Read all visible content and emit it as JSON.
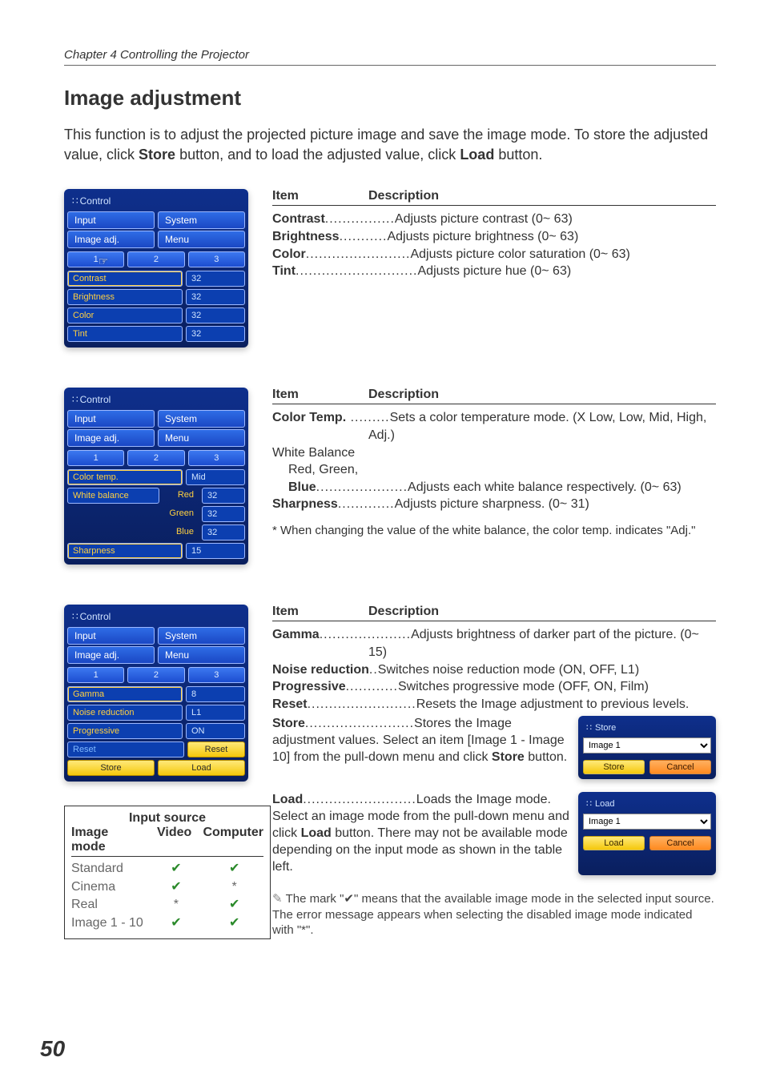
{
  "chapter": "Chapter 4 Controlling the Projector",
  "title": "Image adjustment",
  "intro_a": "This function is to adjust the projected picture image and save the image mode. To store the adjusted value, click ",
  "intro_b": "Store",
  "intro_c": " button, and to load the adjusted value, click ",
  "intro_d": "Load",
  "intro_e": " button.",
  "hdr_item": "Item",
  "hdr_desc": "Description",
  "panel_common": {
    "title": "Control",
    "input": "Input",
    "system": "System",
    "image_adj": "Image adj.",
    "menu": "Menu",
    "tab1": "1",
    "tab2": "2",
    "tab3": "3"
  },
  "panel1": {
    "rows": [
      {
        "label": "Contrast",
        "val": "32"
      },
      {
        "label": "Brightness",
        "val": "32"
      },
      {
        "label": "Color",
        "val": "32"
      },
      {
        "label": "Tint",
        "val": "32"
      }
    ]
  },
  "panel2": {
    "colortemp_label": "Color temp.",
    "colortemp_val": "Mid",
    "wb_label": "White balance",
    "wb": [
      {
        "label": "Red",
        "val": "32"
      },
      {
        "label": "Green",
        "val": "32"
      },
      {
        "label": "Blue",
        "val": "32"
      }
    ],
    "sharp_label": "Sharpness",
    "sharp_val": "15"
  },
  "panel3": {
    "gamma_label": "Gamma",
    "gamma_val": "8",
    "nr_label": "Noise reduction",
    "nr_val": "L1",
    "prog_label": "Progressive",
    "prog_val": "ON",
    "reset_label": "Reset",
    "reset_btn": "Reset",
    "store_btn": "Store",
    "load_btn": "Load"
  },
  "desc1": [
    {
      "k": "Contrast",
      "d": "................",
      "v": "Adjusts picture contrast (0~ 63)"
    },
    {
      "k": "Brightness",
      "d": "...........",
      "v": "Adjusts picture brightness (0~ 63)"
    },
    {
      "k": "Color",
      "d": "........................",
      "v": "Adjusts picture color saturation (0~ 63)"
    },
    {
      "k": "Tint",
      "d": "............................",
      "v": "Adjusts picture hue (0~ 63)"
    }
  ],
  "desc2": {
    "colortemp_k": "Color Temp.",
    "colortemp_d": " .........",
    "colortemp_v1": "Sets a color temperature mode. (X Low, Low, Mid, High,",
    "colortemp_v2": "Adj.)",
    "wb_head": "White Balance",
    "wb_sub": "Red, Green,",
    "blue_k": "Blue",
    "blue_d": ".....................",
    "blue_v": "Adjusts each white balance respectively. (0~ 63)",
    "sharp_k": "Sharpness",
    "sharp_d": ".............",
    "sharp_v": "Adjusts picture sharpness. (0~ 31)"
  },
  "note2": "* When changing the value of the white balance, the color temp. indicates \"Adj.\"",
  "desc3": {
    "gamma_k": "Gamma",
    "gamma_d": ".....................",
    "gamma_v1": "Adjusts brightness of darker part of the picture. (0~",
    "gamma_v2": "15)",
    "nr_k": "Noise reduction",
    "nr_d": "..",
    "nr_v": "Switches noise reduction mode (ON, OFF, L1)",
    "prog_k": "Progressive",
    "prog_d": "............",
    "prog_v": "Switches progressive mode (OFF, ON, Film)",
    "reset_k": "Reset",
    "reset_d": ".........................",
    "reset_v": "Resets the Image adjustment to previous levels.",
    "store_k": "Store",
    "store_d": ".........................",
    "store_v": "Stores the Image adjustment values. Select an item [Image 1 - Image 10] from the pull-down menu and click ",
    "store_b": "Store",
    "store_v2": " button.",
    "load_k": "Load",
    "load_d": "..........................",
    "load_v": "Loads the Image mode. Select an image mode from the pull-down menu and click ",
    "load_b": "Load",
    "load_v2": " button. There may not be available mode depending on the input mode as shown in the table left."
  },
  "mini_store": {
    "title": "Store",
    "option": "Image 1",
    "btn1": "Store",
    "btn2": "Cancel"
  },
  "mini_load": {
    "title": "Load",
    "option": "Image 1",
    "btn1": "Load",
    "btn2": "Cancel"
  },
  "src": {
    "title": "Input source",
    "h1": "Image mode",
    "h2": "Video",
    "h3": "Computer",
    "rows": [
      {
        "n": "Standard",
        "v": "✔",
        "c": "✔"
      },
      {
        "n": "Cinema",
        "v": "✔",
        "c": "*"
      },
      {
        "n": "Real",
        "v": "*",
        "c": "✔"
      },
      {
        "n": "Image 1 - 10",
        "v": "✔",
        "c": "✔"
      }
    ]
  },
  "footnote": "The mark \"✔\" means that the available image mode in the selected input source. The error message appears when selecting the disabled image mode indicated with \"*\".",
  "page_num": "50"
}
